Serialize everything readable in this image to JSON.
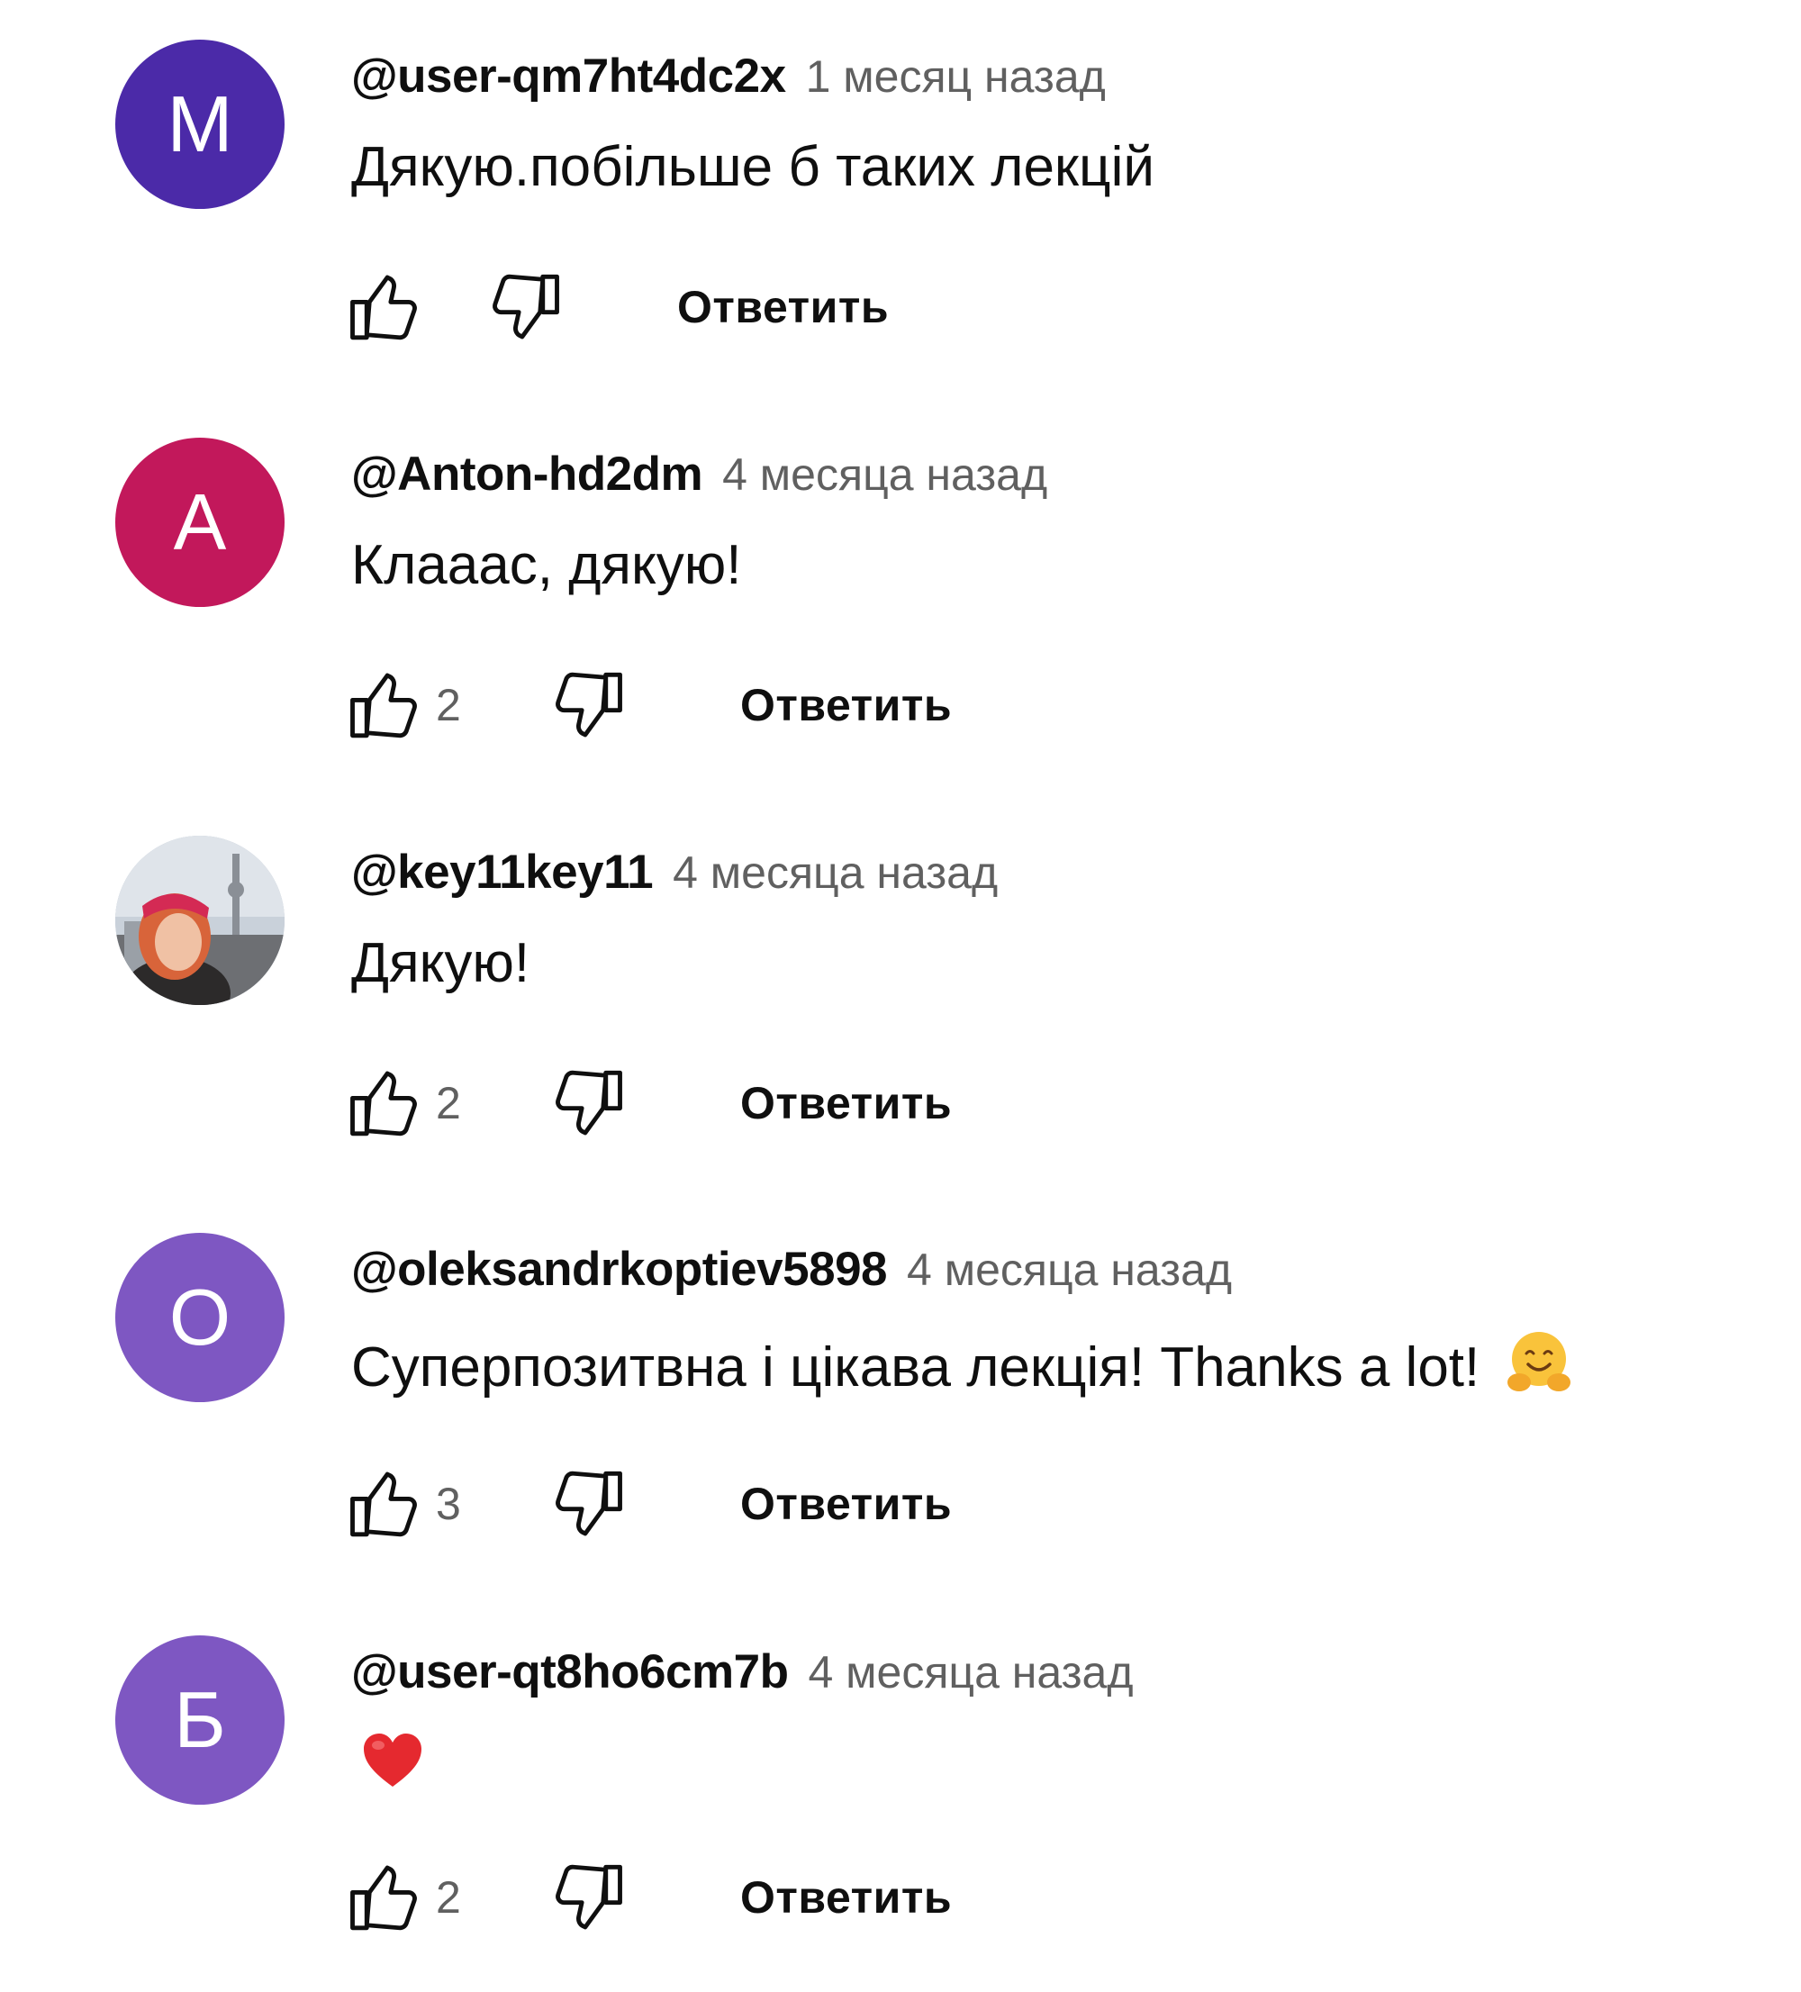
{
  "reply_label": "Ответить",
  "colors": {
    "avatar_m": "#4b2aa8",
    "avatar_a": "#c2185b",
    "avatar_o": "#7e57c2",
    "avatar_b": "#7e57c2",
    "timestamp": "#606060"
  },
  "comments": [
    {
      "author": "@user-qm7ht4dc2x",
      "time": "1 месяц назад",
      "text": "Дякую.побільше б таких лекцій",
      "avatar_letter": "M",
      "likes": ""
    },
    {
      "author": "@Anton-hd2dm",
      "time": "4 месяца назад",
      "text": "Клааас, дякую!",
      "avatar_letter": "A",
      "likes": "2"
    },
    {
      "author": "@key11key11",
      "time": "4 месяца назад",
      "text": "Дякую!",
      "avatar_letter": "",
      "likes": "2"
    },
    {
      "author": "@oleksandrkoptiev5898",
      "time": "4 месяца назад",
      "text": "Суперпозитвна і цікава лекція! Thanks a lot!",
      "avatar_letter": "O",
      "likes": "3",
      "emoji": "hugging-face-emoji"
    },
    {
      "author": "@user-qt8ho6cm7b",
      "time": "4 месяца назад",
      "text": "",
      "avatar_letter": "Б",
      "likes": "2",
      "emoji": "red-heart-emoji"
    }
  ]
}
